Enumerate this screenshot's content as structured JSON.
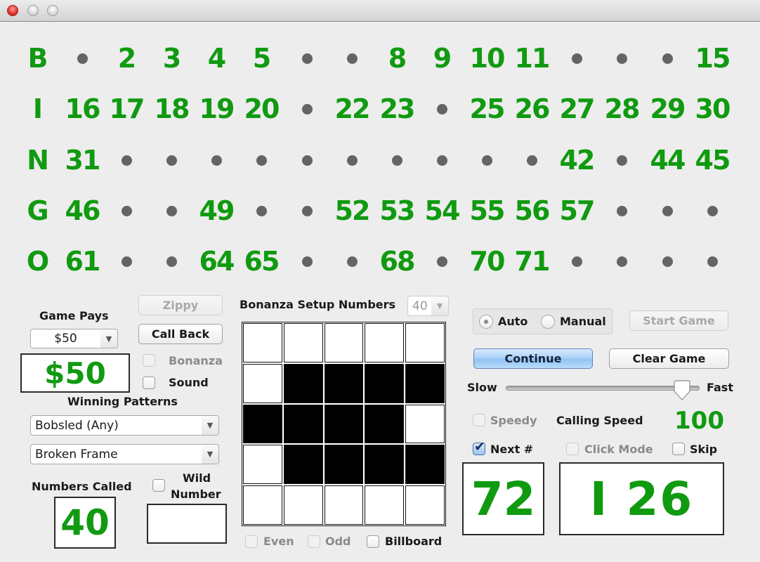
{
  "window": {
    "controls": [
      "close",
      "minimize",
      "maximize"
    ]
  },
  "colors": {
    "called_number": "#109a10",
    "uncalled_dot": "#646464",
    "background": "#ededed"
  },
  "board": {
    "rows": [
      {
        "letter": "B",
        "cells": [
          null,
          "2",
          "3",
          "4",
          "5",
          null,
          null,
          "8",
          "9",
          "10",
          "11",
          null,
          null,
          null,
          "15"
        ]
      },
      {
        "letter": "I",
        "cells": [
          "16",
          "17",
          "18",
          "19",
          "20",
          null,
          "22",
          "23",
          null,
          "25",
          "26",
          "27",
          "28",
          "29",
          "30"
        ]
      },
      {
        "letter": "N",
        "cells": [
          "31",
          null,
          null,
          null,
          null,
          null,
          null,
          null,
          null,
          null,
          null,
          "42",
          null,
          "44",
          "45"
        ]
      },
      {
        "letter": "G",
        "cells": [
          "46",
          null,
          null,
          "49",
          null,
          null,
          "52",
          "53",
          "54",
          "55",
          "56",
          "57",
          null,
          null,
          null
        ]
      },
      {
        "letter": "O",
        "cells": [
          "61",
          null,
          null,
          "64",
          "65",
          null,
          null,
          "68",
          null,
          "70",
          "71",
          null,
          null,
          null,
          null
        ]
      }
    ]
  },
  "left_panel": {
    "game_pays_label": "Game Pays",
    "game_pays_select": "$50",
    "game_pays_display": "$50",
    "zippy_button": "Zippy",
    "call_back_button": "Call Back",
    "bonanza_checkbox": {
      "label": "Bonanza",
      "checked": false,
      "enabled": false
    },
    "sound_checkbox": {
      "label": "Sound",
      "checked": false,
      "enabled": true
    },
    "winning_patterns_label": "Winning Patterns",
    "pattern_select_1": "Bobsled (Any)",
    "pattern_select_2": "Broken Frame",
    "numbers_called_label": "Numbers Called",
    "numbers_called_value": "40",
    "wild_number_checkbox": {
      "checked": false
    },
    "wild_number_label_line1": "Wild",
    "wild_number_label_line2": "Number",
    "wild_number_value": ""
  },
  "center_panel": {
    "bonanza_setup_label": "Bonanza Setup Numbers",
    "bonanza_setup_select": "40",
    "pattern_grid": [
      [
        0,
        0,
        0,
        0,
        0
      ],
      [
        0,
        1,
        1,
        1,
        1
      ],
      [
        1,
        1,
        1,
        1,
        0
      ],
      [
        0,
        1,
        1,
        1,
        1
      ],
      [
        0,
        0,
        0,
        0,
        0
      ]
    ],
    "even_checkbox": {
      "label": "Even",
      "checked": false,
      "enabled": false
    },
    "odd_checkbox": {
      "label": "Odd",
      "checked": false,
      "enabled": false
    },
    "billboard_checkbox": {
      "label": "Billboard",
      "checked": false,
      "enabled": true
    }
  },
  "right_panel": {
    "mode_auto": {
      "label": "Auto",
      "selected": true
    },
    "mode_manual": {
      "label": "Manual",
      "selected": false
    },
    "start_game_button": "Start Game",
    "continue_button": "Continue",
    "clear_game_button": "Clear Game",
    "slider_min_label": "Slow",
    "slider_max_label": "Fast",
    "speed_slider_fraction": 0.95,
    "speedy_checkbox": {
      "label": "Speedy",
      "checked": false,
      "enabled": false
    },
    "calling_speed_label": "Calling Speed",
    "calling_speed_value": "100",
    "next_checkbox": {
      "label": "Next #",
      "checked": true,
      "enabled": true
    },
    "click_mode_checkbox": {
      "label": "Click Mode",
      "checked": false,
      "enabled": false
    },
    "skip_checkbox": {
      "label": "Skip",
      "checked": false,
      "enabled": true
    },
    "next_number_value": "72",
    "current_call_value": "I 26"
  }
}
